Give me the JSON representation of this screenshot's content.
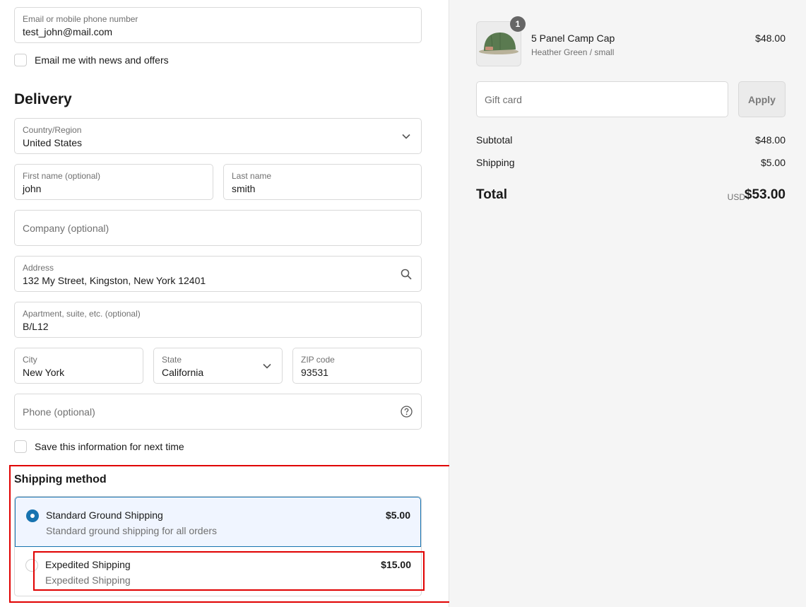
{
  "contact": {
    "email_label": "Email or mobile phone number",
    "email_value": "test_john@mail.com",
    "news_label": "Email me with news and offers"
  },
  "delivery": {
    "heading": "Delivery",
    "country_label": "Country/Region",
    "country_value": "United States",
    "first_name_label": "First name (optional)",
    "first_name_value": "john",
    "last_name_label": "Last name",
    "last_name_value": "smith",
    "company_placeholder": "Company (optional)",
    "address_label": "Address",
    "address_value": "132 My Street, Kingston, New York 12401",
    "apartment_label": "Apartment, suite, etc. (optional)",
    "apartment_value": "B/L12",
    "city_label": "City",
    "city_value": "New York",
    "state_label": "State",
    "state_value": "California",
    "zip_label": "ZIP code",
    "zip_value": "93531",
    "phone_placeholder": "Phone (optional)",
    "save_label": "Save this information for next time"
  },
  "shipping": {
    "heading": "Shipping method",
    "options": [
      {
        "title": "Standard Ground Shipping",
        "subtitle": "Standard ground shipping for all orders",
        "price": "$5.00",
        "selected": true
      },
      {
        "title": "Expedited Shipping",
        "subtitle": "Expedited Shipping",
        "price": "$15.00",
        "selected": false
      }
    ]
  },
  "summary": {
    "item": {
      "name": "5 Panel Camp Cap",
      "variant": "Heather Green / small",
      "price": "$48.00",
      "quantity": "1"
    },
    "gift_placeholder": "Gift card",
    "apply_label": "Apply",
    "subtotal_label": "Subtotal",
    "subtotal_value": "$48.00",
    "shipping_label": "Shipping",
    "shipping_value": "$5.00",
    "total_label": "Total",
    "currency": "USD",
    "total_value": "$53.00"
  },
  "colors": {
    "accent": "#1773b0",
    "highlight": "#e00000"
  }
}
